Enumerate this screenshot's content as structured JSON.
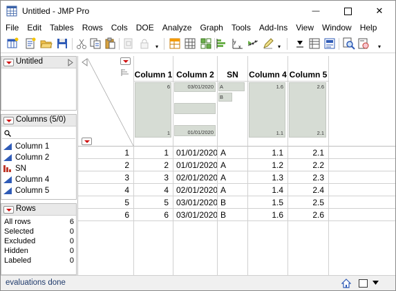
{
  "window": {
    "title": "Untitled - JMP Pro",
    "minimize_glyph": "—",
    "close_glyph": "✕"
  },
  "menu": [
    "File",
    "Edit",
    "Tables",
    "Rows",
    "Cols",
    "DOE",
    "Analyze",
    "Graph",
    "Tools",
    "Add-Ins",
    "View",
    "Window",
    "Help"
  ],
  "toolbar": {
    "icons": [
      "new-data-table-icon",
      "new-script-icon",
      "open-icon",
      "save-icon",
      "cut-icon",
      "copy-icon",
      "paste-icon",
      "copy-disabled-icon",
      "lock-disabled-icon",
      "data-table-list-icon",
      "table-icon",
      "subset-icon",
      "distribution-icon",
      "fit-y-by-x-icon",
      "fit-model-icon",
      "pencil-icon",
      "text-tool-icon",
      "data-grid-icon",
      "report-icon",
      "magnifier-icon",
      "annotate-icon"
    ]
  },
  "table_panel": {
    "title": "Untitled"
  },
  "columns_panel": {
    "title": "Columns (5/0)",
    "search_glyph": "🔍",
    "items": [
      {
        "label": "Column 1",
        "type": "continuous"
      },
      {
        "label": "Column 2",
        "type": "continuous"
      },
      {
        "label": "SN",
        "type": "nominal"
      },
      {
        "label": "Column 4",
        "type": "continuous"
      },
      {
        "label": "Column 5",
        "type": "continuous"
      }
    ]
  },
  "rows_panel": {
    "title": "Rows",
    "items": [
      {
        "label": "All rows",
        "value": "6"
      },
      {
        "label": "Selected",
        "value": "0"
      },
      {
        "label": "Excluded",
        "value": "0"
      },
      {
        "label": "Hidden",
        "value": "0"
      },
      {
        "label": "Labeled",
        "value": "0"
      }
    ]
  },
  "grid": {
    "columns": [
      "Column 1",
      "Column 2",
      "SN",
      "Column 4",
      "Column 5"
    ],
    "summaries": {
      "col1": {
        "top": "6",
        "bottom": "1"
      },
      "col2": {
        "top": "03/01/2020",
        "bottom": "01/01/2020"
      },
      "sn": {
        "levels": [
          "A",
          "B"
        ]
      },
      "col4": {
        "top": "1.6",
        "bottom": "1.1"
      },
      "col5": {
        "top": "2.6",
        "bottom": "2.1"
      }
    },
    "rows": [
      {
        "n": "1",
        "c1": "1",
        "c2": "01/01/2020",
        "sn": "A",
        "c4": "1.1",
        "c5": "2.1"
      },
      {
        "n": "2",
        "c1": "2",
        "c2": "01/01/2020",
        "sn": "A",
        "c4": "1.2",
        "c5": "2.2"
      },
      {
        "n": "3",
        "c1": "3",
        "c2": "02/01/2020",
        "sn": "A",
        "c4": "1.3",
        "c5": "2.3"
      },
      {
        "n": "4",
        "c1": "4",
        "c2": "02/01/2020",
        "sn": "A",
        "c4": "1.4",
        "c5": "2.4"
      },
      {
        "n": "5",
        "c1": "5",
        "c2": "03/01/2020",
        "sn": "B",
        "c4": "1.5",
        "c5": "2.5"
      },
      {
        "n": "6",
        "c1": "6",
        "c2": "03/01/2020",
        "sn": "B",
        "c4": "1.6",
        "c5": "2.6"
      }
    ]
  },
  "status": {
    "text": "evaluations done"
  },
  "colors": {
    "summary_band": "#d6dcd4",
    "red_triangle": "#d01010",
    "status_text": "#1f3a6b",
    "continuous_icon": "#2f5bb7",
    "nominal_icon": "#c0392b"
  }
}
